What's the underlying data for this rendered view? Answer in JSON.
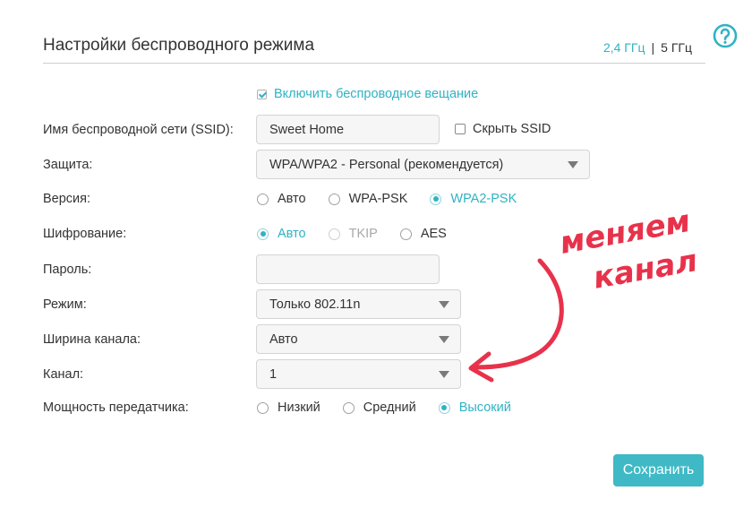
{
  "header": {
    "title": "Настройки беспроводного режима",
    "band_24": "2,4 ГГц",
    "band_sep": "|",
    "band_5": "5 ГГц"
  },
  "help_icon": "question-circle-icon",
  "broadcast": {
    "label": "Включить беспроводное вещание",
    "checked": true
  },
  "ssid": {
    "label": "Имя беспроводной сети (SSID):",
    "value": "Sweet Home",
    "hide_label": "Скрыть SSID",
    "hide_checked": false
  },
  "security": {
    "label": "Защита:",
    "value": "WPA/WPA2 - Personal (рекомендуется)"
  },
  "version": {
    "label": "Версия:",
    "options": [
      "Авто",
      "WPA-PSK",
      "WPA2-PSK"
    ],
    "selected": "WPA2-PSK"
  },
  "encryption": {
    "label": "Шифрование:",
    "options": [
      "Авто",
      "TKIP",
      "AES"
    ],
    "selected": "Авто",
    "disabled": [
      "TKIP"
    ]
  },
  "password": {
    "label": "Пароль:",
    "value": ""
  },
  "mode": {
    "label": "Режим:",
    "value": "Только 802.11n"
  },
  "channel_width": {
    "label": "Ширина канала:",
    "value": "Авто"
  },
  "channel": {
    "label": "Канал:",
    "value": "1"
  },
  "tx_power": {
    "label": "Мощность передатчика:",
    "options": [
      "Низкий",
      "Средний",
      "Высокий"
    ],
    "selected": "Высокий"
  },
  "save_label": "Сохранить",
  "annotation": {
    "line1": "меняем",
    "line2": "канал",
    "color": "#e8324b"
  },
  "colors": {
    "accent": "#2fb3c3",
    "button": "#3fb9c5"
  }
}
